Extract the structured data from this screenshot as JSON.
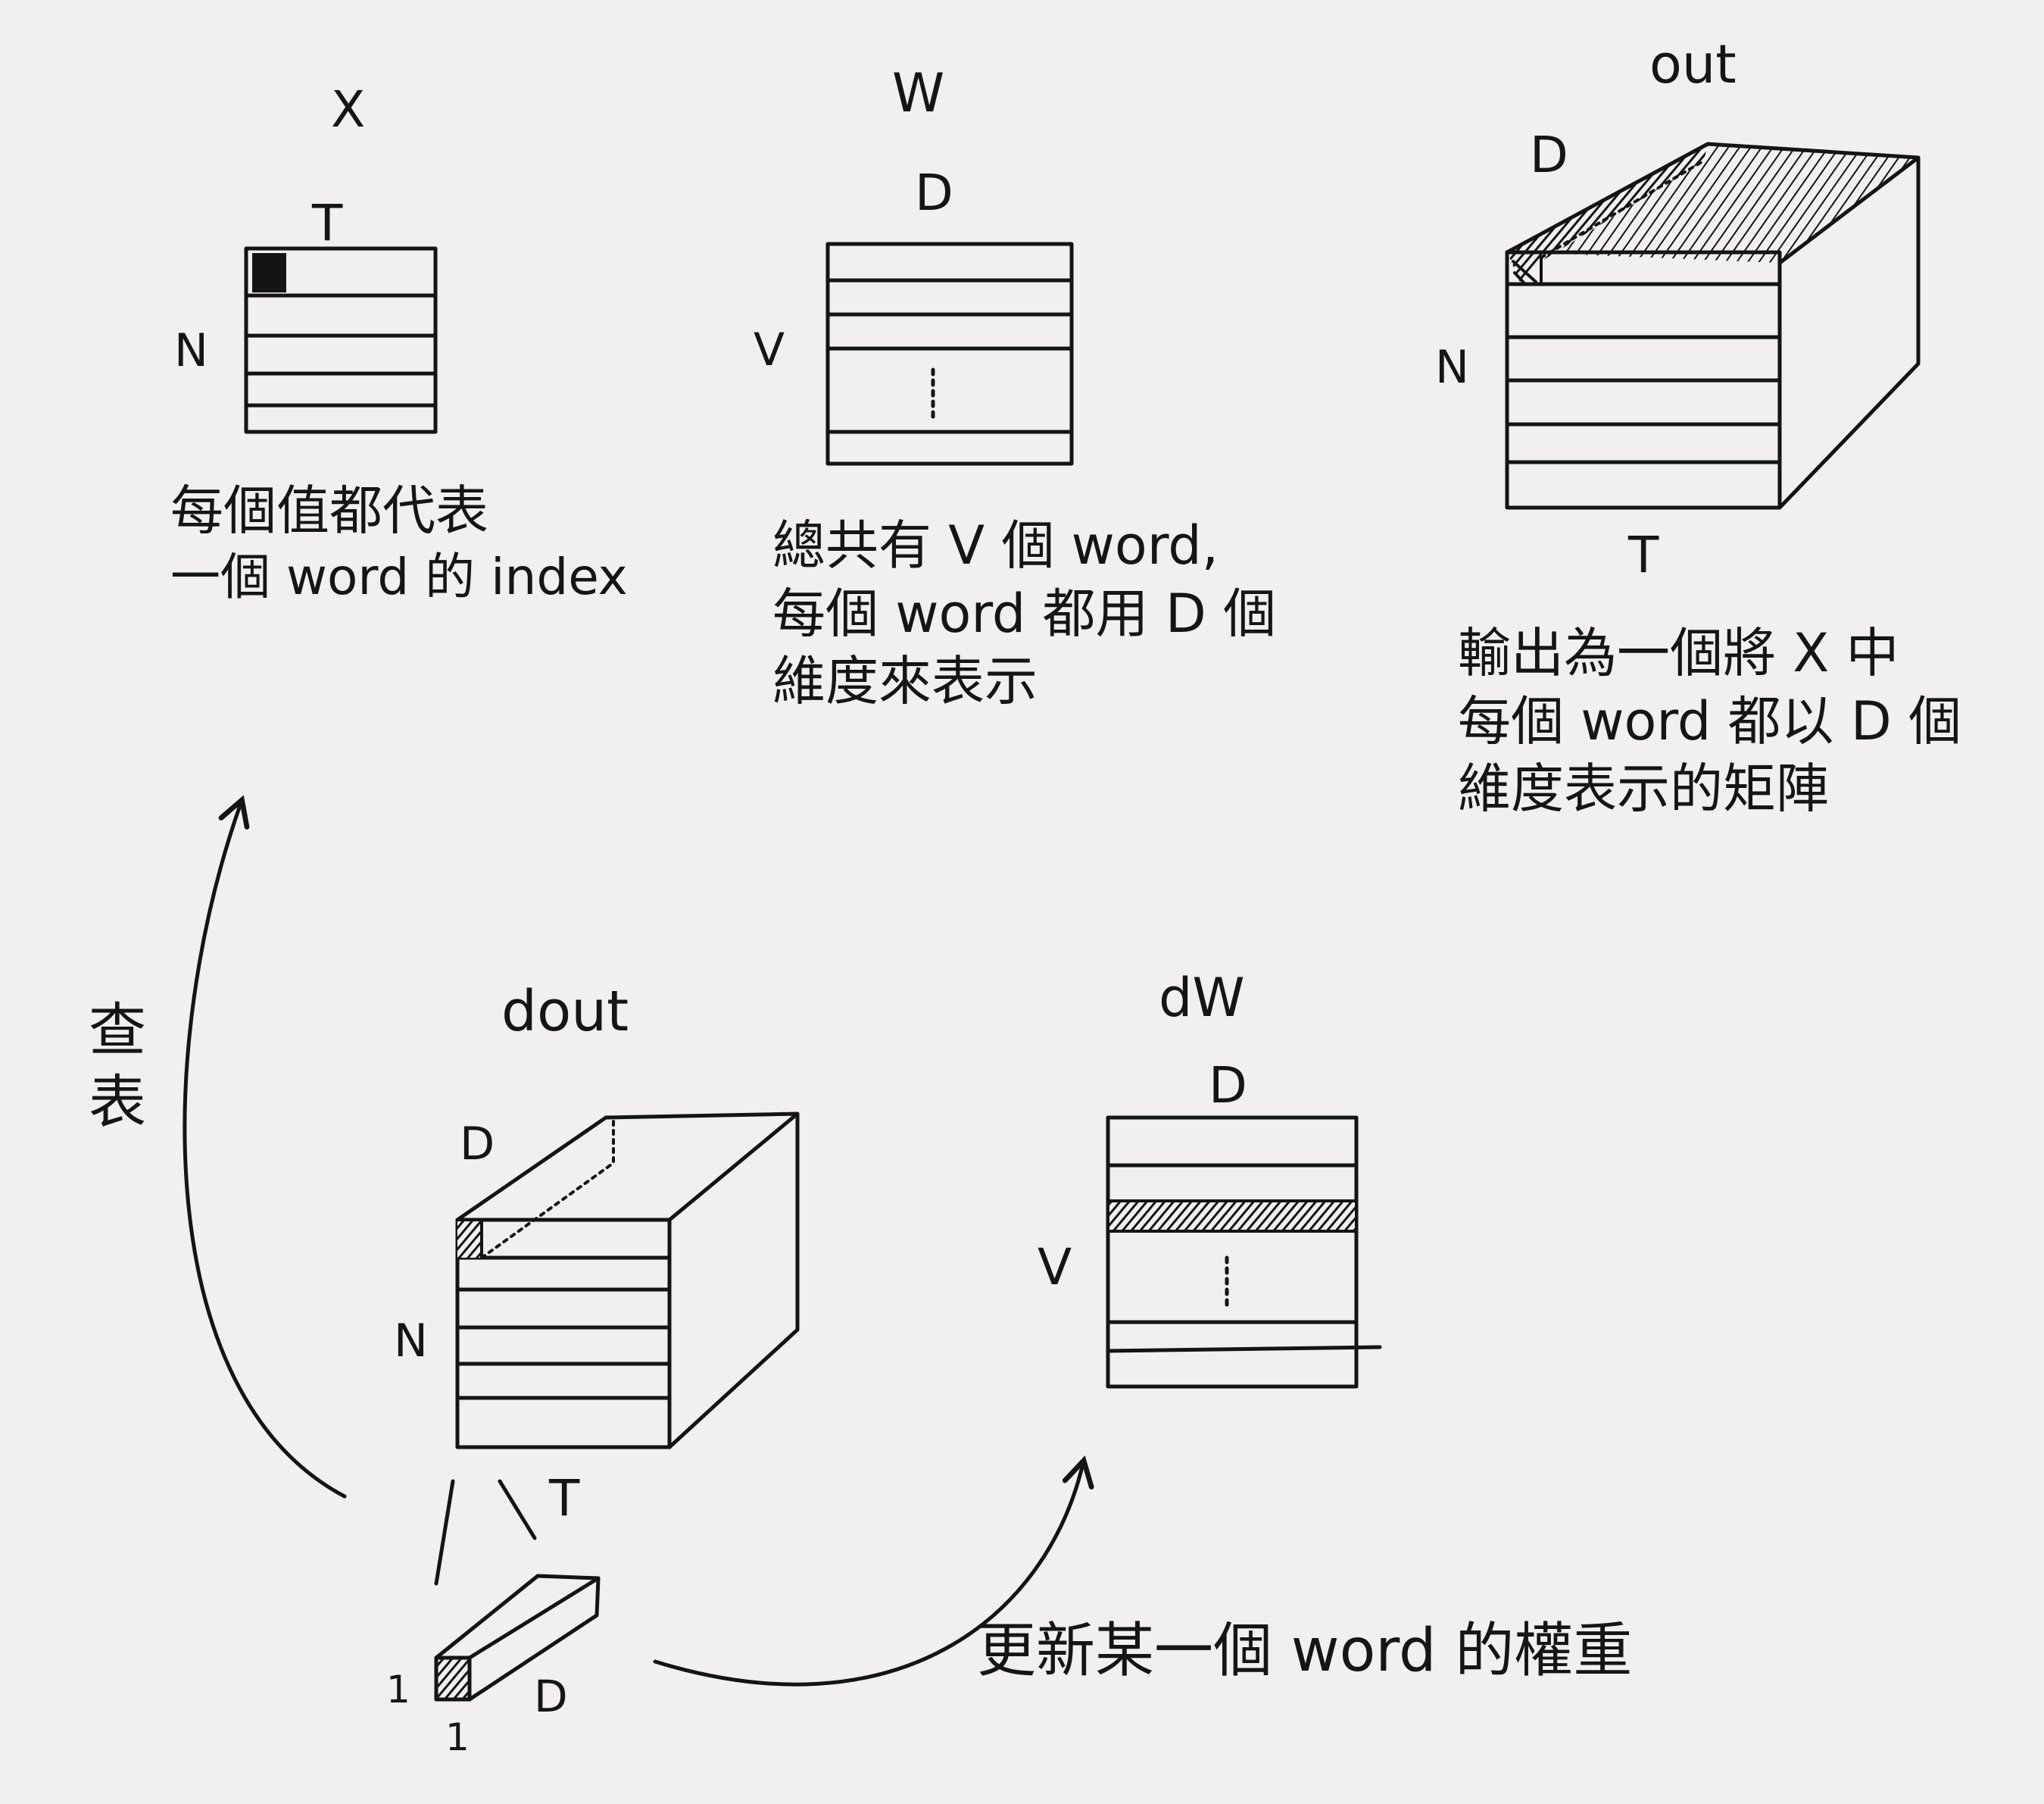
{
  "panels": {
    "x": {
      "title": "X",
      "cols_label": "T",
      "rows_label": "N",
      "caption": [
        "每個值都代表",
        "一個 word 的 index"
      ]
    },
    "w": {
      "title": "W",
      "cols_label": "D",
      "rows_label": "V",
      "caption": [
        "總共有 V 個 word,",
        "每個 word 都用 D 個",
        "維度來表示"
      ]
    },
    "out": {
      "title": "out",
      "depth_label": "D",
      "rows_label": "N",
      "cols_label": "T",
      "caption": [
        "輸出為一個將 X 中",
        "每個 word 都以 D 個",
        "維度表示的矩陣"
      ]
    },
    "dout": {
      "title": "dout",
      "depth_label": "D",
      "rows_label": "N",
      "cols_label": "T"
    },
    "dw": {
      "title": "dW",
      "cols_label": "D",
      "rows_label": "V"
    },
    "slice": {
      "label_height": "1",
      "label_width": "1",
      "label_depth": "D"
    }
  },
  "arrows": {
    "lookup_label": "查表",
    "update_label": "更新某一個 word 的權重"
  },
  "colors": {
    "ink": "#141414",
    "paper": "#f1f0ee"
  }
}
